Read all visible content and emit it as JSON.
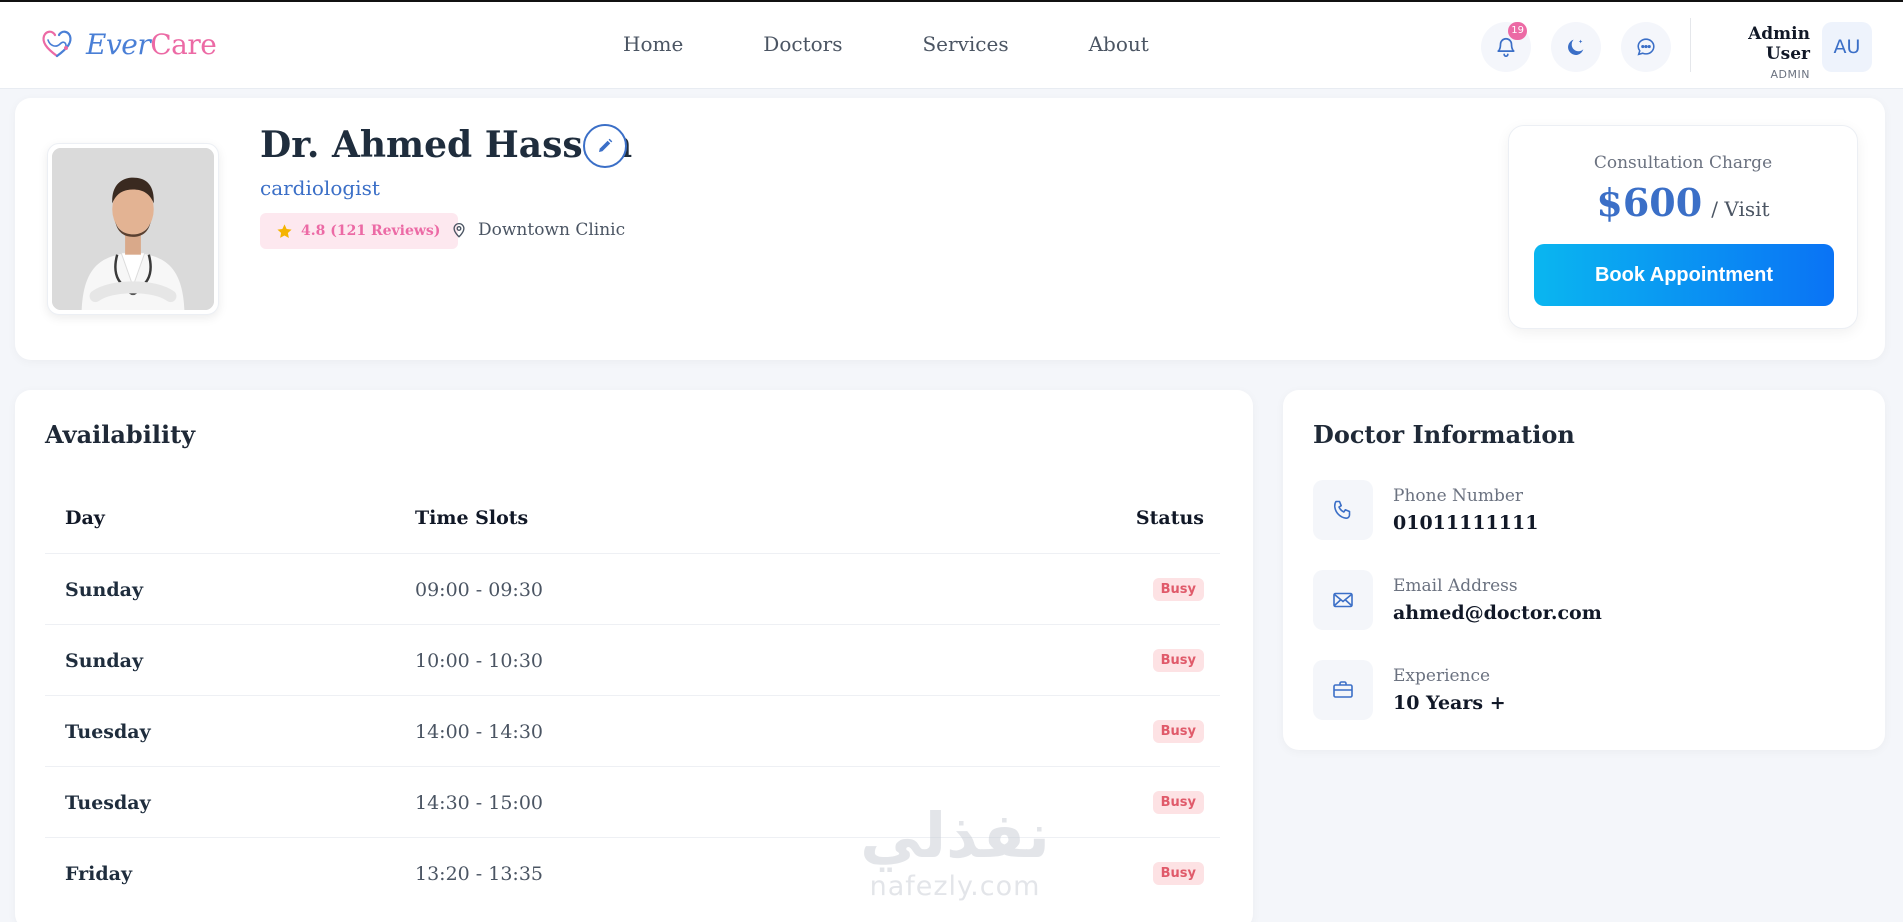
{
  "navbar": {
    "brand": {
      "part1": "Ever",
      "part2": "Care"
    },
    "links": [
      "Home",
      "Doctors",
      "Services",
      "About"
    ],
    "notifications_count": "19",
    "user": {
      "name": "Admin User",
      "role": "ADMIN",
      "initials": "AU"
    }
  },
  "profile": {
    "name": "Dr. Ahmed Hassan",
    "specialty": "cardiologist",
    "rating": "4.8 (121 Reviews)",
    "location": "Downtown Clinic",
    "consultation": {
      "label": "Consultation Charge",
      "price": "$600",
      "unit": "/ Visit"
    },
    "book_label": "Book Appointment"
  },
  "availability": {
    "title": "Availability",
    "headers": {
      "day": "Day",
      "time": "Time Slots",
      "status": "Status"
    },
    "rows": [
      {
        "day": "Sunday",
        "time": "09:00 - 09:30",
        "status": "Busy"
      },
      {
        "day": "Sunday",
        "time": "10:00 - 10:30",
        "status": "Busy"
      },
      {
        "day": "Tuesday",
        "time": "14:00 - 14:30",
        "status": "Busy"
      },
      {
        "day": "Tuesday",
        "time": "14:30 - 15:00",
        "status": "Busy"
      },
      {
        "day": "Friday",
        "time": "13:20 - 13:35",
        "status": "Busy"
      }
    ]
  },
  "doctor_info": {
    "title": "Doctor Information",
    "items": [
      {
        "label": "Phone Number",
        "value": "01011111111",
        "icon": "phone-icon"
      },
      {
        "label": "Email Address",
        "value": "ahmed@doctor.com",
        "icon": "mail-icon"
      },
      {
        "label": "Experience",
        "value": "10 Years +",
        "icon": "briefcase-icon"
      }
    ]
  },
  "watermark": {
    "arabic": "نفذلي",
    "latin": "nafezly.com"
  },
  "colors": {
    "primary": "#3b6fc7",
    "accent_pink": "#ec6aa5",
    "busy_red": "#e05a6a"
  }
}
